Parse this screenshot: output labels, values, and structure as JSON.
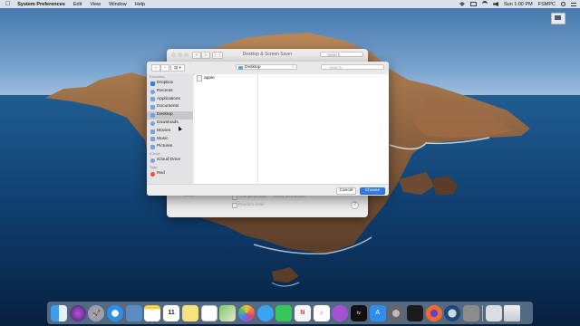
{
  "menubar": {
    "app_name": "System Preferences",
    "menus": [
      "Edit",
      "View",
      "Window",
      "Help"
    ],
    "clock": "Sun 1:00 PM",
    "user": "FSMPC"
  },
  "desktop_icon": {
    "label": ""
  },
  "background_window": {
    "title": "Desktop & Screen Saver",
    "search_placeholder": "Search",
    "option_change_picture": "Change picture:",
    "option_interval": "Every 30 minutes",
    "option_random": "Random order",
    "add_button": "+",
    "help_button": "?"
  },
  "open_panel": {
    "location": "Desktop",
    "search_placeholder": "Search",
    "view_button": "▤ ▾",
    "sidebar": {
      "favorites_header": "Favorites",
      "favorites": [
        "Dropbox",
        "Recents",
        "Applications",
        "Documents",
        "Desktop",
        "Downloads",
        "Movies",
        "Music",
        "Pictures"
      ],
      "selected": "Desktop",
      "icloud_header": "iCloud",
      "icloud": [
        "iCloud Drive"
      ],
      "tags_header": "Tags",
      "tags": [
        "Red"
      ]
    },
    "files": [
      "apple"
    ],
    "cancel_label": "Cancel",
    "choose_label": "Choose"
  },
  "dock": {
    "icons": [
      "finder-icon",
      "siri-icon",
      "launchpad-icon",
      "safari-icon",
      "preview-icon",
      "notes-icon",
      "calendar-icon",
      "stickies-icon",
      "reminders-icon",
      "maps-icon",
      "photos-icon",
      "messages-icon",
      "facetime-icon",
      "news-icon",
      "music-icon",
      "podcasts-icon",
      "tv-icon",
      "app-store-icon",
      "system-preferences-icon",
      "stocks-icon",
      "firefox-icon",
      "quicktime-icon",
      "image-capture-icon",
      "downloads-folder-icon",
      "trash-icon"
    ],
    "calendar_day": "11",
    "tv_label": "tv"
  }
}
